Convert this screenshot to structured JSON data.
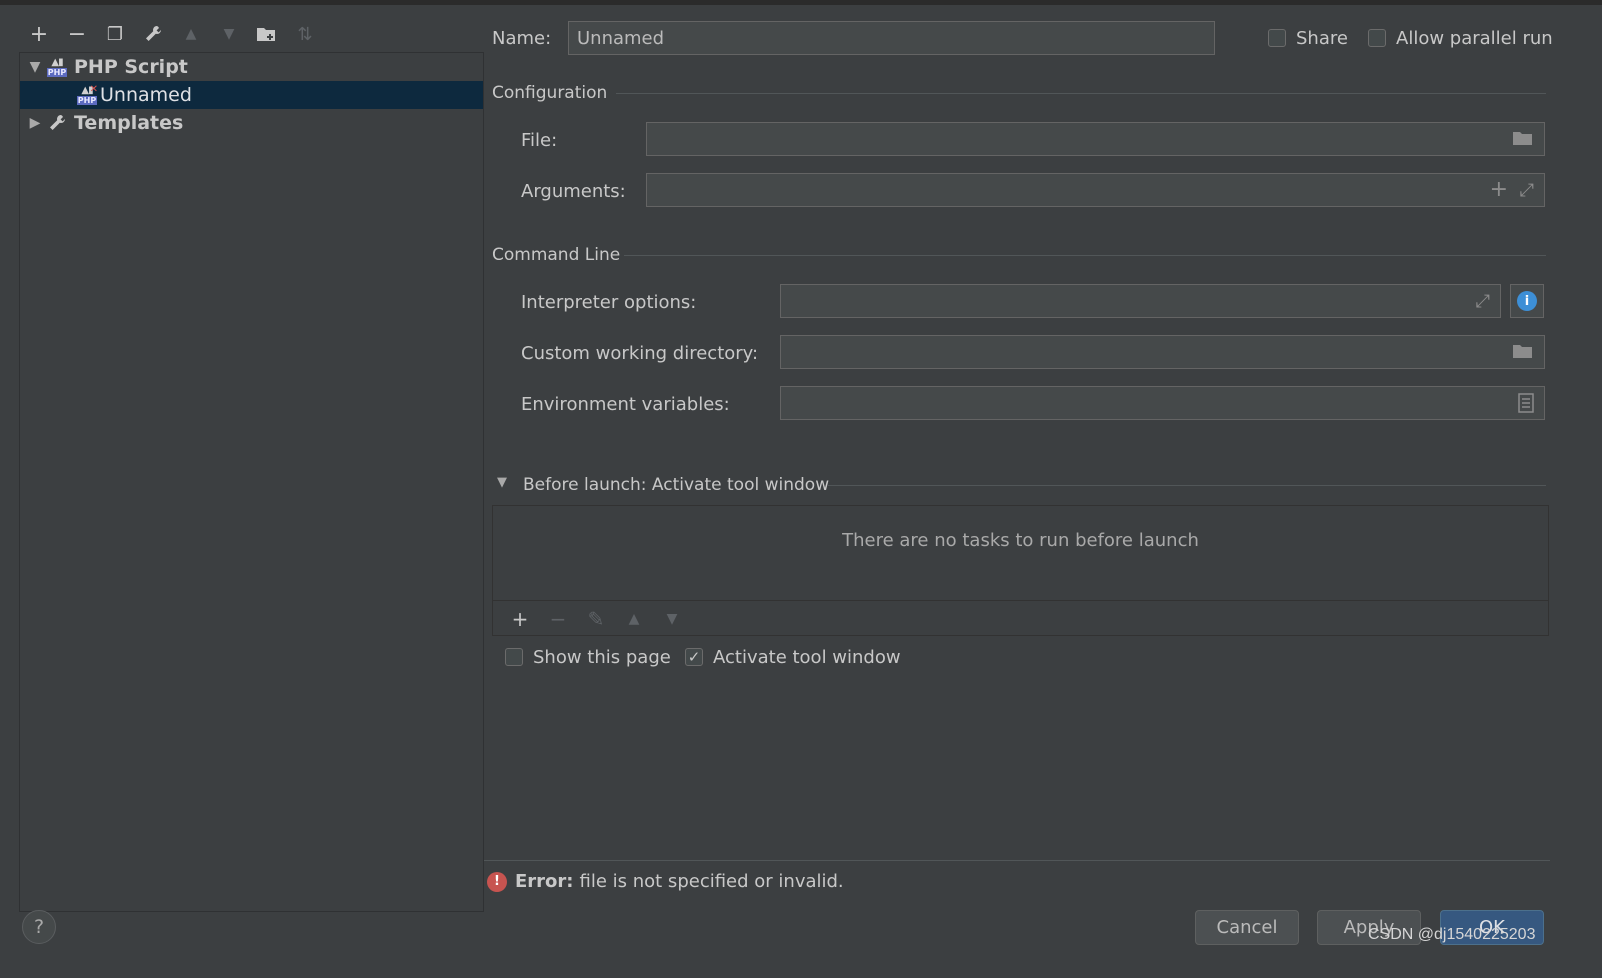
{
  "toolbar": {
    "items": [
      {
        "icon": "plus-icon",
        "glyph": "+"
      },
      {
        "icon": "minus-icon",
        "glyph": "−"
      },
      {
        "icon": "copy-icon",
        "glyph": "⧉"
      },
      {
        "icon": "wrench-icon",
        "glyph": "🔧"
      },
      {
        "icon": "move-up-icon",
        "glyph": "▲"
      },
      {
        "icon": "move-down-icon",
        "glyph": "▼"
      },
      {
        "icon": "folder-add-icon",
        "glyph": "📁"
      },
      {
        "icon": "sort-icon",
        "glyph": "⇅"
      }
    ]
  },
  "tree": {
    "php_script": "PHP Script",
    "unnamed": "Unnamed",
    "templates": "Templates"
  },
  "header": {
    "name_label": "Name:",
    "name_value": "Unnamed",
    "share_label": "Share",
    "share_checked": false,
    "parallel_label": "Allow parallel run",
    "parallel_checked": false
  },
  "configuration": {
    "title": "Configuration",
    "file_label": "File:",
    "file_value": "",
    "arguments_label": "Arguments:",
    "arguments_value": ""
  },
  "command_line": {
    "title": "Command Line",
    "interpreter_label": "Interpreter options:",
    "interpreter_value": "",
    "workdir_label": "Custom working directory:",
    "workdir_value": "",
    "env_label": "Environment variables:",
    "env_value": ""
  },
  "before_launch": {
    "title": "Before launch: Activate tool window",
    "empty_text": "There are no tasks to run before launch",
    "show_page_label": "Show this page",
    "show_page_checked": false,
    "activate_label": "Activate tool window",
    "activate_checked": true
  },
  "error": {
    "prefix": "Error:",
    "message": "file is not specified or invalid."
  },
  "buttons": {
    "cancel": "Cancel",
    "apply": "Apply",
    "ok": "OK",
    "help": "?"
  },
  "watermark": "CSDN @dj1540225203",
  "colors": {
    "background": "#3c3f41",
    "selection": "#0d293e",
    "default_button": "#365880",
    "error": "#c75450",
    "info": "#3d8fd6"
  }
}
